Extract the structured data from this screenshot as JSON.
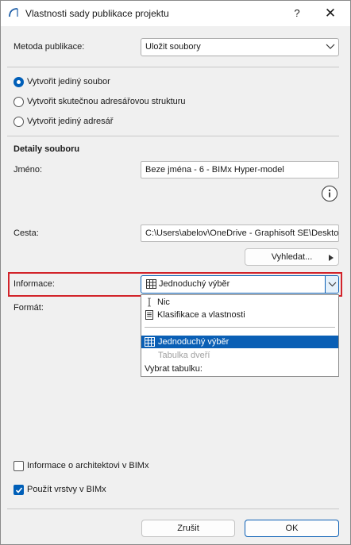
{
  "dialog": {
    "title": "Vlastnosti sady publikace projektu",
    "help": "?",
    "close": "✕"
  },
  "publish_method": {
    "label": "Metoda publikace:",
    "value": "Uložit soubory"
  },
  "radios": [
    {
      "label": "Vytvořit jediný soubor",
      "checked": true
    },
    {
      "label": "Vytvořit skutečnou adresářovou strukturu",
      "checked": false
    },
    {
      "label": "Vytvořit jediný adresář",
      "checked": false
    }
  ],
  "file_details": {
    "heading": "Detaily souboru",
    "name_label": "Jméno:",
    "name_value": "Beze jména - 6 - BIMx Hyper-model",
    "info_icon": "info-icon",
    "path_label": "Cesta:",
    "path_value": "C:\\Users\\abelov\\OneDrive - Graphisoft SE\\Desktop",
    "browse_label": "Vyhledat..."
  },
  "information": {
    "label": "Informace:",
    "value": "Jednoduchý výběr",
    "format_label": "Formát:",
    "options": [
      {
        "label": "Nic",
        "icon": "text-cursor-icon",
        "state": "normal"
      },
      {
        "label": "Klasifikace a vlastnosti",
        "icon": "document-icon",
        "state": "normal"
      },
      {
        "label": "Jednoduchý výběr",
        "icon": "table-icon",
        "state": "selected"
      },
      {
        "label": "Tabulka dveří",
        "icon": "",
        "state": "disabled"
      },
      {
        "label": "Vybrat tabulku:",
        "icon": "",
        "state": "normal"
      }
    ]
  },
  "checkboxes": [
    {
      "label": "Informace o architektovi v BIMx",
      "checked": false
    },
    {
      "label": "Použít vrstvy v BIMx",
      "checked": true
    }
  ],
  "buttons": {
    "cancel": "Zrušit",
    "ok": "OK"
  },
  "colors": {
    "accent": "#005fb8",
    "selection": "#0a5fb5",
    "highlight": "#d2232a"
  }
}
